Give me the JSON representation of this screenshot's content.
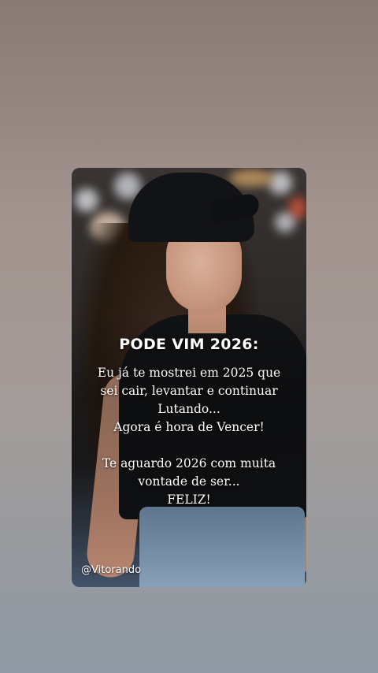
{
  "post": {
    "heading": "PODE VIM 2026:",
    "lines": [
      "Eu já te mostrei em 2025 que",
      "sei cair, levantar e continuar",
      "Lutando...",
      "Agora é hora de Vencer!",
      "",
      "Te aguardo 2026 com muita",
      "vontade de ser...",
      "FELIZ!"
    ],
    "watermark": "@Vitorando"
  }
}
